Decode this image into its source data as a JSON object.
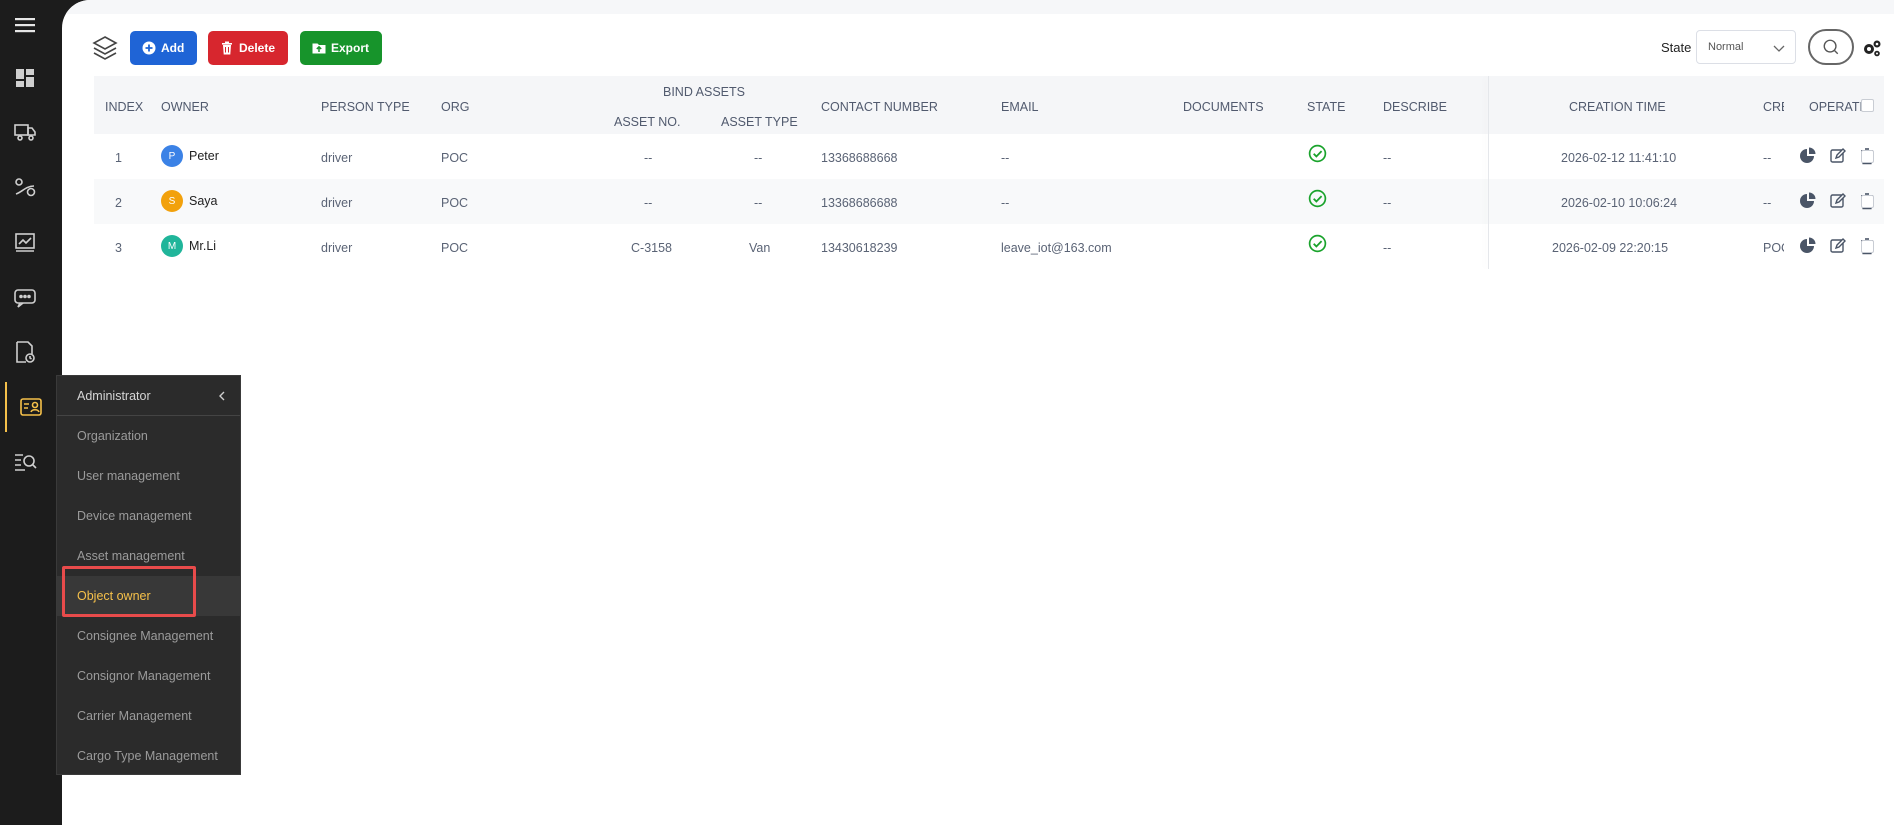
{
  "toolbar": {
    "add_label": "Add",
    "delete_label": "Delete",
    "export_label": "Export",
    "state_label": "State",
    "state_value": "Normal"
  },
  "table": {
    "headers": {
      "index": "INDEX",
      "owner": "OWNER",
      "person_type": "PERSON TYPE",
      "org": "ORG",
      "bind_assets": "BIND ASSETS",
      "asset_no": "ASSET NO.",
      "asset_type": "ASSET TYPE",
      "contact_number": "CONTACT NUMBER",
      "email": "EMAIL",
      "documents": "DOCUMENTS",
      "state": "STATE",
      "describe": "DESCRIBE",
      "creation_time": "CREATION TIME",
      "creator_truncated": "CRE",
      "operate": "OPERATE"
    },
    "rows": [
      {
        "index": "1",
        "initial": "P",
        "avatar_color": "#3b82e6",
        "owner": "Peter",
        "person_type": "driver",
        "org": "POC",
        "asset_no": "--",
        "asset_type": "--",
        "contact": "13368688668",
        "email": "--",
        "describe": "--",
        "creation_time": "2026-02-12 11:41:10",
        "creator": "--"
      },
      {
        "index": "2",
        "initial": "S",
        "avatar_color": "#f2a10c",
        "owner": "Saya",
        "person_type": "driver",
        "org": "POC",
        "asset_no": "--",
        "asset_type": "--",
        "contact": "13368686688",
        "email": "--",
        "describe": "--",
        "creation_time": "2026-02-10 10:06:24",
        "creator": "--"
      },
      {
        "index": "3",
        "initial": "M",
        "avatar_color": "#20b59a",
        "owner": "Mr.Li",
        "person_type": "driver",
        "org": "POC",
        "asset_no": "C-3158",
        "asset_type": "Van",
        "contact": "13430618239",
        "email": "leave_iot@163.com",
        "describe": "--",
        "creation_time": "2026-02-09 22:20:15",
        "creator": "POC"
      }
    ]
  },
  "menu": {
    "title": "Administrator",
    "items": [
      {
        "label": "Organization"
      },
      {
        "label": "User management"
      },
      {
        "label": "Device management"
      },
      {
        "label": "Asset management"
      },
      {
        "label": "Object owner"
      },
      {
        "label": "Consignee Management"
      },
      {
        "label": "Consignor Management"
      },
      {
        "label": "Carrier Management"
      },
      {
        "label": "Cargo Type Management"
      }
    ],
    "active_index": 4
  },
  "colors": {
    "accent": "#f5c04a",
    "add": "#1f64d6",
    "delete": "#d7262e",
    "export": "#17942b",
    "state_ok": "#1aa32c",
    "highlight": "#e84b4b"
  }
}
